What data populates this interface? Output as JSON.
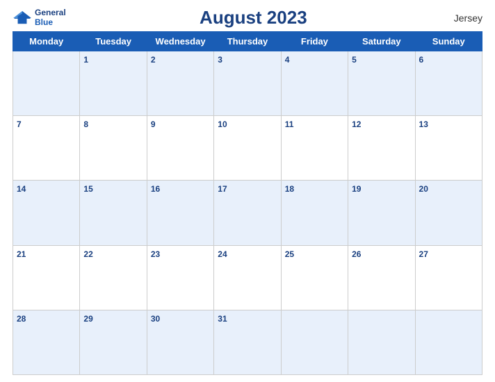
{
  "header": {
    "title": "August 2023",
    "region": "Jersey",
    "logo_line1": "General",
    "logo_line2": "Blue"
  },
  "days_of_week": [
    "Monday",
    "Tuesday",
    "Wednesday",
    "Thursday",
    "Friday",
    "Saturday",
    "Sunday"
  ],
  "weeks": [
    [
      "",
      "1",
      "2",
      "3",
      "4",
      "5",
      "6"
    ],
    [
      "7",
      "8",
      "9",
      "10",
      "11",
      "12",
      "13"
    ],
    [
      "14",
      "15",
      "16",
      "17",
      "18",
      "19",
      "20"
    ],
    [
      "21",
      "22",
      "23",
      "24",
      "25",
      "26",
      "27"
    ],
    [
      "28",
      "29",
      "30",
      "31",
      "",
      "",
      ""
    ]
  ]
}
